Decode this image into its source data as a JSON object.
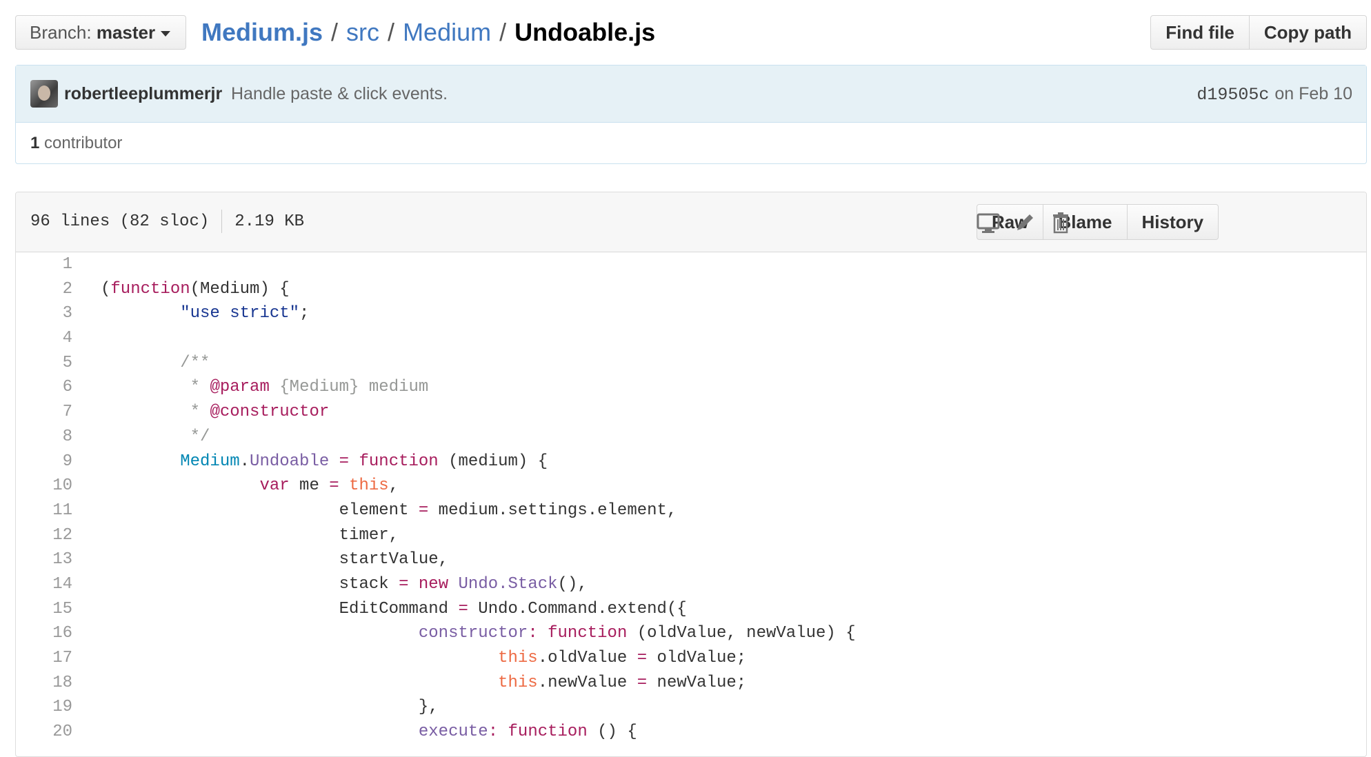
{
  "branch": {
    "label": "Branch:",
    "name": "master"
  },
  "breadcrumb": {
    "root": "Medium.js",
    "parts": [
      "src",
      "Medium"
    ],
    "file": "Undoable.js",
    "sep": "/"
  },
  "header_actions": {
    "find_file": "Find file",
    "copy_path": "Copy path"
  },
  "commit": {
    "author": "robertleeplummerjr",
    "message": "Handle paste & click events.",
    "sha": "d19505c",
    "date": "on Feb 10"
  },
  "contributors": {
    "count": "1",
    "label": "contributor"
  },
  "file": {
    "lines_info": "96 lines (82 sloc)",
    "size": "2.19 KB",
    "actions": {
      "raw": "Raw",
      "blame": "Blame",
      "history": "History"
    },
    "icons": [
      "desktop-icon",
      "pencil-icon",
      "trash-icon"
    ]
  },
  "code_lines": [
    {
      "n": "1",
      "tokens": []
    },
    {
      "n": "2",
      "tokens": [
        [
          "",
          "("
        ],
        [
          "key",
          "function"
        ],
        [
          "",
          "(Medium) {"
        ]
      ]
    },
    {
      "n": "3",
      "tokens": [
        [
          "",
          "        "
        ],
        [
          "str",
          "\"use strict\""
        ],
        [
          "",
          ";"
        ]
      ]
    },
    {
      "n": "4",
      "tokens": []
    },
    {
      "n": "5",
      "tokens": [
        [
          "",
          "        "
        ],
        [
          "com",
          "/**"
        ]
      ]
    },
    {
      "n": "6",
      "tokens": [
        [
          "",
          "        "
        ],
        [
          "com",
          " * "
        ],
        [
          "key",
          "@param"
        ],
        [
          "com",
          " {Medium} medium"
        ]
      ]
    },
    {
      "n": "7",
      "tokens": [
        [
          "",
          "        "
        ],
        [
          "com",
          " * "
        ],
        [
          "key",
          "@constructor"
        ]
      ]
    },
    {
      "n": "8",
      "tokens": [
        [
          "",
          "        "
        ],
        [
          "com",
          " */"
        ]
      ]
    },
    {
      "n": "9",
      "tokens": [
        [
          "",
          "        "
        ],
        [
          "sup",
          "Medium"
        ],
        [
          "",
          "."
        ],
        [
          "ent",
          "Undoable"
        ],
        [
          "",
          " "
        ],
        [
          "key",
          "="
        ],
        [
          "",
          " "
        ],
        [
          "key",
          "function"
        ],
        [
          "",
          " (medium) {"
        ]
      ]
    },
    {
      "n": "10",
      "tokens": [
        [
          "",
          "                "
        ],
        [
          "key",
          "var"
        ],
        [
          "",
          " me "
        ],
        [
          "key",
          "="
        ],
        [
          "",
          " "
        ],
        [
          "this",
          "this"
        ],
        [
          "",
          ","
        ]
      ]
    },
    {
      "n": "11",
      "tokens": [
        [
          "",
          "                        element "
        ],
        [
          "key",
          "="
        ],
        [
          "",
          " medium.settings.element,"
        ]
      ]
    },
    {
      "n": "12",
      "tokens": [
        [
          "",
          "                        timer,"
        ]
      ]
    },
    {
      "n": "13",
      "tokens": [
        [
          "",
          "                        startValue,"
        ]
      ]
    },
    {
      "n": "14",
      "tokens": [
        [
          "",
          "                        stack "
        ],
        [
          "key",
          "="
        ],
        [
          "",
          " "
        ],
        [
          "key",
          "new"
        ],
        [
          "",
          " "
        ],
        [
          "ent",
          "Undo.Stack"
        ],
        [
          "",
          "(),"
        ]
      ]
    },
    {
      "n": "15",
      "tokens": [
        [
          "",
          "                        EditCommand "
        ],
        [
          "key",
          "="
        ],
        [
          "",
          " Undo.Command.extend({"
        ]
      ]
    },
    {
      "n": "16",
      "tokens": [
        [
          "",
          "                                "
        ],
        [
          "ent",
          "constructor"
        ],
        [
          "key",
          ":"
        ],
        [
          "",
          " "
        ],
        [
          "key",
          "function"
        ],
        [
          "",
          " (oldValue, newValue) {"
        ]
      ]
    },
    {
      "n": "17",
      "tokens": [
        [
          "",
          "                                        "
        ],
        [
          "this",
          "this"
        ],
        [
          "",
          ".oldValue "
        ],
        [
          "key",
          "="
        ],
        [
          "",
          " oldValue;"
        ]
      ]
    },
    {
      "n": "18",
      "tokens": [
        [
          "",
          "                                        "
        ],
        [
          "this",
          "this"
        ],
        [
          "",
          ".newValue "
        ],
        [
          "key",
          "="
        ],
        [
          "",
          " newValue;"
        ]
      ]
    },
    {
      "n": "19",
      "tokens": [
        [
          "",
          "                                },"
        ]
      ]
    },
    {
      "n": "20",
      "tokens": [
        [
          "",
          "                                "
        ],
        [
          "ent",
          "execute"
        ],
        [
          "key",
          ":"
        ],
        [
          "",
          " "
        ],
        [
          "key",
          "function"
        ],
        [
          "",
          " () {"
        ]
      ]
    }
  ]
}
